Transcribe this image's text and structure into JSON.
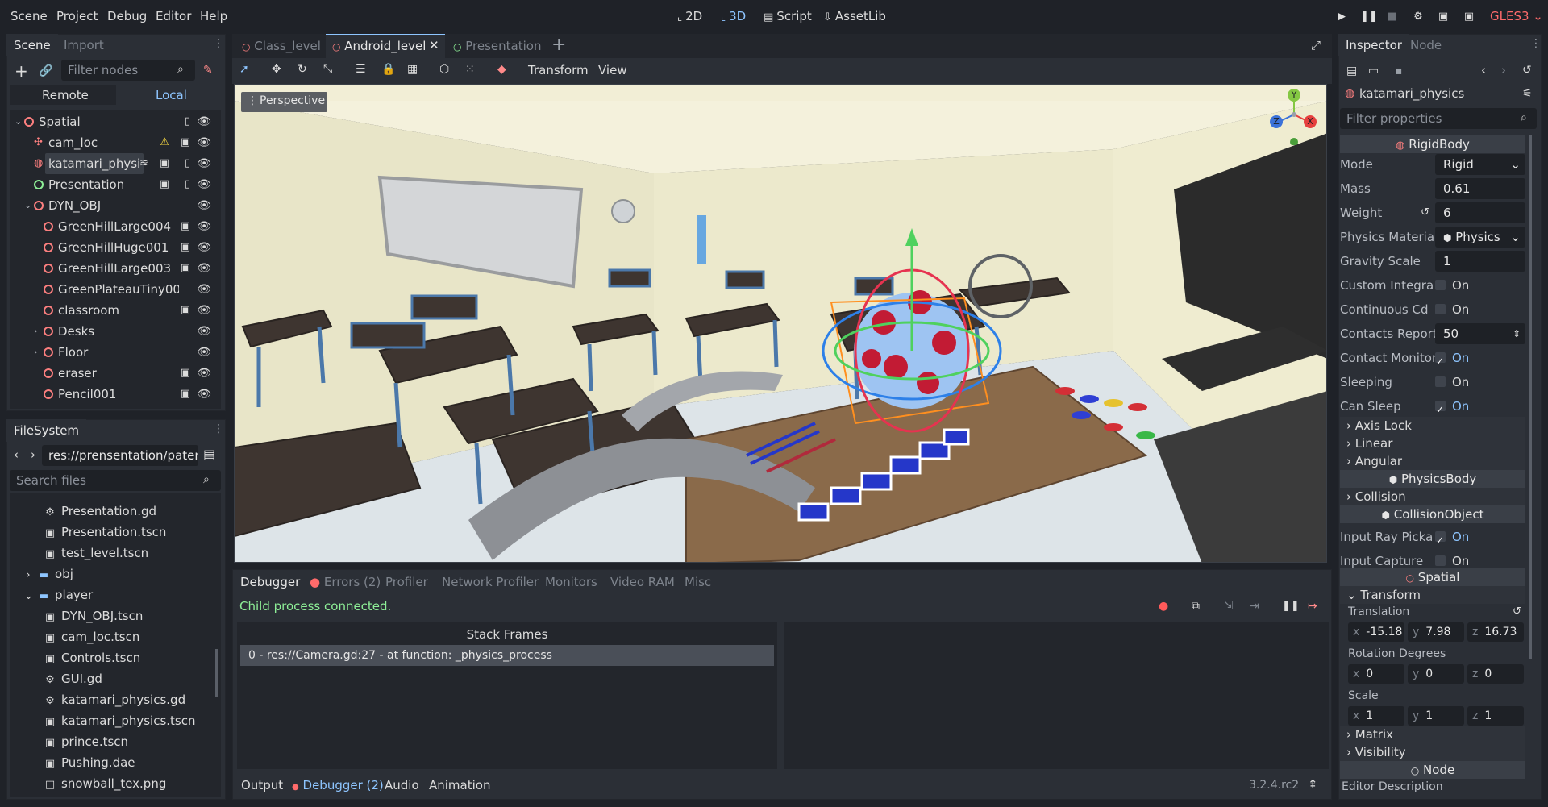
{
  "menu": [
    "Scene",
    "Project",
    "Debug",
    "Editor",
    "Help"
  ],
  "workspaces": [
    {
      "icon": "2d-icon",
      "label": "2D"
    },
    {
      "icon": "3d-icon",
      "label": "3D"
    },
    {
      "icon": "script-icon",
      "label": "Script"
    },
    {
      "icon": "assetlib-icon",
      "label": "AssetLib"
    }
  ],
  "renderer": "GLES3",
  "scene_dock": {
    "tabs": [
      "Scene",
      "Import"
    ],
    "filter_placeholder": "Filter nodes",
    "remote": "Remote",
    "local": "Local",
    "nodes": [
      {
        "label": "Spatial",
        "arrow": "⌄"
      },
      {
        "label": "cam_loc"
      },
      {
        "label": "katamari_physi"
      },
      {
        "label": "Presentation"
      },
      {
        "label": "DYN_OBJ",
        "arrow": "⌄"
      },
      {
        "label": "GreenHillLarge004"
      },
      {
        "label": "GreenHillHuge001"
      },
      {
        "label": "GreenHillLarge003"
      },
      {
        "label": "GreenPlateauTiny00"
      },
      {
        "label": "classroom"
      },
      {
        "label": "Desks",
        "arrow": "›"
      },
      {
        "label": "Floor",
        "arrow": "›"
      },
      {
        "label": "eraser"
      },
      {
        "label": "Pencil001"
      }
    ]
  },
  "filesystem": {
    "title": "FileSystem",
    "path": "res://prensentation/patent",
    "search_placeholder": "Search files",
    "files": [
      {
        "name": "Presentation.gd"
      },
      {
        "name": "Presentation.tscn"
      },
      {
        "name": "test_level.tscn"
      },
      {
        "name": "obj"
      },
      {
        "name": "player"
      },
      {
        "name": "DYN_OBJ.tscn"
      },
      {
        "name": "cam_loc.tscn"
      },
      {
        "name": "Controls.tscn"
      },
      {
        "name": "GUI.gd"
      },
      {
        "name": "katamari_physics.gd"
      },
      {
        "name": "katamari_physics.tscn"
      },
      {
        "name": "prince.tscn"
      },
      {
        "name": "Pushing.dae"
      },
      {
        "name": "snowball_tex.png"
      }
    ]
  },
  "scene_tabs": [
    "Class_level",
    "Android_level",
    "Presentation"
  ],
  "viewport": {
    "toolbar_menus": [
      "Transform",
      "View"
    ],
    "perspective_label": "Perspective",
    "gizmo_axes": [
      "Y",
      "X",
      "Z"
    ]
  },
  "bottom": {
    "tabs": [
      "Debugger",
      "Errors (2)",
      "Profiler",
      "Network Profiler",
      "Monitors",
      "Video RAM",
      "Misc"
    ],
    "status": "Child process connected.",
    "stack_frames_title": "Stack Frames",
    "stack_frame": "0 - res://Camera.gd:27 - at function: _physics_process",
    "panel_tabs": [
      "Output",
      "Debugger (2)",
      "Audio",
      "Animation"
    ],
    "version": "3.2.4.rc2"
  },
  "inspector": {
    "tabs": [
      "Inspector",
      "Node"
    ],
    "object_name": "katamari_physics",
    "filter_placeholder": "Filter properties",
    "rigidbody_section": "RigidBody",
    "props": [
      {
        "label": "Mode",
        "value": "Rigid"
      },
      {
        "label": "Mass",
        "value": "0.61"
      },
      {
        "label": "Weight",
        "value": "6"
      },
      {
        "label": "Physics Material",
        "value": "Physics"
      },
      {
        "label": "Gravity Scale",
        "value": "1"
      },
      {
        "label": "Custom Integra",
        "value": "On"
      },
      {
        "label": "Continuous Cd",
        "value": "On"
      },
      {
        "label": "Contacts Report",
        "value": "50"
      },
      {
        "label": "Contact Monitor",
        "value": "On"
      },
      {
        "label": "Sleeping",
        "value": "On"
      },
      {
        "label": "Can Sleep",
        "value": "On"
      }
    ],
    "rb_groups": [
      "Axis Lock",
      "Linear",
      "Angular"
    ],
    "physicsbody_section": "PhysicsBody",
    "collision_group": "Collision",
    "collisionobject_section": "CollisionObject",
    "co_props": [
      {
        "label": "Input Ray Picka",
        "value": "On"
      },
      {
        "label": "Input Capture",
        "value": "On"
      }
    ],
    "spatial_section": "Spatial",
    "transform_group": "Transform",
    "translation_label": "Translation",
    "translation": {
      "x": "-15.18",
      "y": "7.98",
      "z": "16.73"
    },
    "rotation_label": "Rotation Degrees",
    "rotation": {
      "x": "0",
      "y": "0",
      "z": "0"
    },
    "scale_label": "Scale",
    "scale": {
      "x": "1",
      "y": "1",
      "z": "1"
    },
    "more_groups": [
      "Matrix",
      "Visibility"
    ],
    "node_section": "Node",
    "editor_description": "Editor Description"
  }
}
